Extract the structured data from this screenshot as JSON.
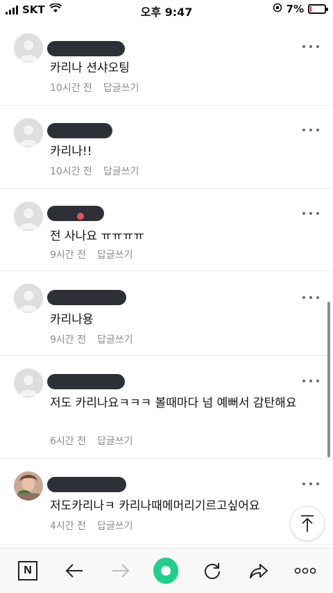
{
  "status_bar": {
    "carrier": "SKT",
    "time": "오후 9:47",
    "battery_percent": "7%",
    "battery_level": 0.07
  },
  "comments": [
    {
      "text": "카리나 션샤오팅",
      "time": "10시간 전",
      "reply_label": "답글쓰기"
    },
    {
      "text": "카리나!!",
      "time": "10시간 전",
      "reply_label": "답글쓰기"
    },
    {
      "text": "전 사나요 ㅠㅠㅠㅠ",
      "time": "9시간 전",
      "reply_label": "답글쓰기"
    },
    {
      "text": "카리나용",
      "time": "9시간 전",
      "reply_label": "답글쓰기"
    },
    {
      "text": "저도 카리나요ㅋㅋㅋ 볼때마다 넘 예뻐서 감탄해요",
      "time": "6시간 전",
      "reply_label": "답글쓰기"
    },
    {
      "text": "저도카리나ㅋ 카리나때메머리기르고싶어요",
      "time": "4시간 전",
      "reply_label": "답글쓰기"
    }
  ],
  "toolbar": {
    "home_label": "N"
  },
  "colors": {
    "accent_green": "#1fd08a",
    "name_redaction": "#2e3038",
    "meta_gray": "#8a8a8a"
  }
}
